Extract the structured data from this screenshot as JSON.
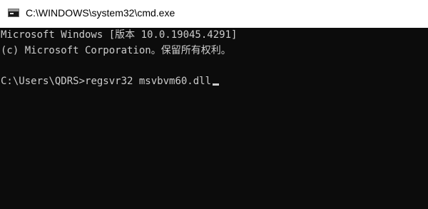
{
  "window": {
    "title": "C:\\WINDOWS\\system32\\cmd.exe",
    "icon": "cmd-icon"
  },
  "console": {
    "version_line": "Microsoft Windows [版本 10.0.19045.4291]",
    "copyright_line": "(c) Microsoft Corporation。保留所有权利。",
    "prompt": "C:\\Users\\QDRS>",
    "command": "regsvr32 msvbvm60.dll"
  },
  "colors": {
    "console_background": "#0c0c0c",
    "console_text": "#cccccc",
    "titlebar_background": "#ffffff"
  }
}
